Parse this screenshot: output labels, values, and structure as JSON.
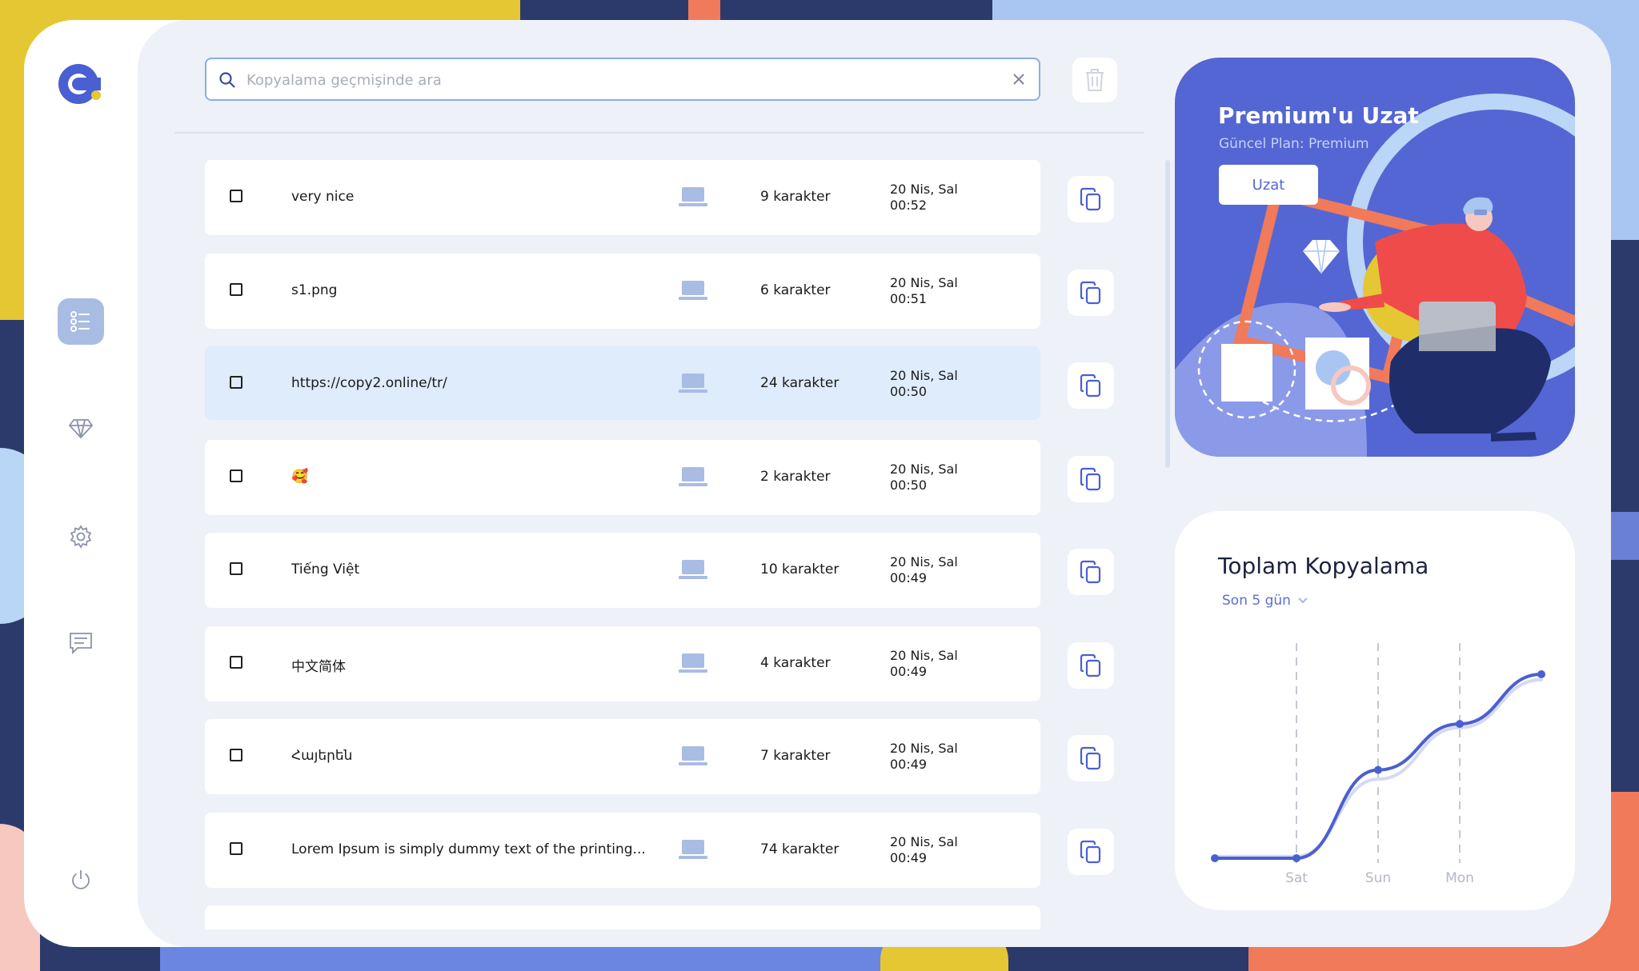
{
  "search": {
    "placeholder": "Kopyalama geçmişinde ara"
  },
  "rows": [
    {
      "text": "very nice",
      "count": "9 karakter",
      "date_line1": "20 Nis, Sal",
      "date_line2": "00:52",
      "highlighted": false
    },
    {
      "text": "s1.png",
      "count": "6 karakter",
      "date_line1": "20 Nis, Sal",
      "date_line2": "00:51",
      "highlighted": false
    },
    {
      "text": "https://copy2.online/tr/",
      "count": "24 karakter",
      "date_line1": "20 Nis, Sal",
      "date_line2": "00:50",
      "highlighted": true
    },
    {
      "text": "🥰",
      "count": "2 karakter",
      "date_line1": "20 Nis, Sal",
      "date_line2": "00:50",
      "highlighted": false
    },
    {
      "text": "Tiếng Việt",
      "count": "10 karakter",
      "date_line1": "20 Nis, Sal",
      "date_line2": "00:49",
      "highlighted": false
    },
    {
      "text": "中文简体",
      "count": "4 karakter",
      "date_line1": "20 Nis, Sal",
      "date_line2": "00:49",
      "highlighted": false
    },
    {
      "text": "Հայերեն",
      "count": "7 karakter",
      "date_line1": "20 Nis, Sal",
      "date_line2": "00:49",
      "highlighted": false
    },
    {
      "text": "Lorem Ipsum is simply dummy text of the printing...",
      "count": "74 karakter",
      "date_line1": "20 Nis, Sal",
      "date_line2": "00:49",
      "highlighted": false
    }
  ],
  "premium": {
    "title": "Premium'u Uzat",
    "plan": "Güncel Plan: Premium",
    "button": "Uzat"
  },
  "stats": {
    "title": "Toplam Kopyalama",
    "period": "Son 5 gün"
  },
  "chart_data": {
    "type": "line",
    "categories": [
      "Sat",
      "Sun",
      "Mon"
    ],
    "x": [
      0,
      1,
      2,
      3,
      4
    ],
    "series": [
      {
        "values": [
          0,
          0,
          48,
          73,
          100
        ]
      },
      {
        "values": [
          1,
          1,
          43,
          71,
          97
        ]
      }
    ],
    "ylim": [
      0,
      100
    ],
    "grid": "vertical dashed at Sat, Sun, Mon",
    "colors": [
      "#4a5fd1",
      "#d4d9f5"
    ]
  },
  "colors": {
    "accent": "#5466d3",
    "panel": "#eef1f8",
    "highlight_row": "#deecfb",
    "active_nav": "#a9bce3"
  },
  "icons": {
    "logo": "copy2-logo",
    "nav": [
      "list-icon",
      "diamond-icon",
      "gear-icon",
      "chat-icon",
      "power-icon"
    ],
    "row_device": "laptop-icon",
    "row_action": "copy-icon"
  }
}
